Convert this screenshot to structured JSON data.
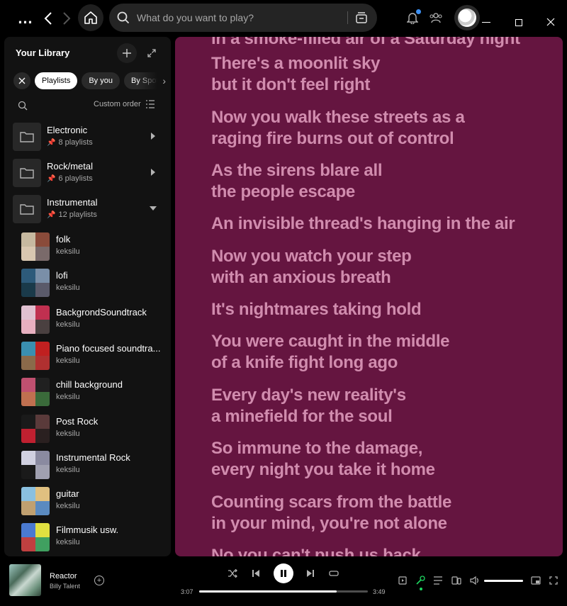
{
  "topbar": {
    "search_placeholder": "What do you want to play?",
    "icons": [
      "more-icon",
      "back-icon",
      "forward-icon",
      "home-icon",
      "search-icon",
      "browse-icon",
      "bell-icon",
      "friends-icon",
      "avatar",
      "minimize-icon",
      "maximize-icon",
      "close-icon"
    ]
  },
  "library": {
    "title": "Your Library",
    "filters": [
      "Playlists",
      "By you",
      "By Spoti"
    ],
    "active_filter": "Playlists",
    "sort_label": "Custom order",
    "folders": [
      {
        "name": "Electronic",
        "sub": "8 playlists",
        "expanded": false
      },
      {
        "name": "Rock/metal",
        "sub": "6 playlists",
        "expanded": false
      },
      {
        "name": "Instrumental",
        "sub": "12 playlists",
        "expanded": true
      }
    ],
    "playlists": [
      {
        "name": "folk",
        "owner": "keksilu",
        "colors": [
          "#c7b9a0",
          "#8a4b3a",
          "#d9c7b0",
          "#7a6a6a"
        ]
      },
      {
        "name": "lofi",
        "owner": "keksilu",
        "colors": [
          "#2d5a7a",
          "#7a8fa8",
          "#1a3a4a",
          "#5a5a6a"
        ]
      },
      {
        "name": "BackgrondSoundtrack",
        "owner": "keksilu",
        "colors": [
          "#e0c0d0",
          "#c03050",
          "#e8b0c0",
          "#4a4040"
        ]
      },
      {
        "name": "Piano focused soundtra...",
        "owner": "keksilu",
        "colors": [
          "#3a8fb0",
          "#c02020",
          "#8a6a4a",
          "#b03030"
        ]
      },
      {
        "name": "chill background",
        "owner": "keksilu",
        "colors": [
          "#c05070",
          "#202020",
          "#c07050",
          "#3a6a3a"
        ]
      },
      {
        "name": "Post Rock",
        "owner": "keksilu",
        "colors": [
          "#1a1a1a",
          "#5a3a3a",
          "#c02030",
          "#2a2020"
        ]
      },
      {
        "name": "Instrumental Rock",
        "owner": "keksilu",
        "colors": [
          "#d0d0e0",
          "#8a8aa0",
          "#1a1a1a",
          "#a0a0b0"
        ]
      },
      {
        "name": "guitar",
        "owner": "keksilu",
        "colors": [
          "#8ac0e0",
          "#e0c080",
          "#c0a070",
          "#5a8ac0"
        ]
      },
      {
        "name": "Filmmusik usw.",
        "owner": "keksilu",
        "colors": [
          "#4a7ad0",
          "#e0e040",
          "#c04040",
          "#40a060"
        ]
      }
    ]
  },
  "lyrics": {
    "lines": [
      {
        "text": "in a smoke-filled air of a Saturday night"
      },
      {
        "text": "There's a moonlit sky"
      },
      {
        "text": "but it don't feel right"
      },
      {
        "text": "Now you walk these streets as a"
      },
      {
        "text": "raging fire burns out of control"
      },
      {
        "text": "As the sirens blare all"
      },
      {
        "text": "the people escape"
      },
      {
        "text": "An invisible thread's hanging in the air"
      },
      {
        "text": "Now you watch your step"
      },
      {
        "text": "with an anxious breath"
      },
      {
        "text": "It's nightmares taking hold"
      },
      {
        "text": "You were caught in the middle"
      },
      {
        "text": "of a knife fight long ago"
      },
      {
        "text": "Every day's new reality's"
      },
      {
        "text": "a minefield for the soul"
      },
      {
        "text": "So immune to the damage,"
      },
      {
        "text": "every night you take it home"
      },
      {
        "text": "Counting scars from the battle"
      },
      {
        "text": "in your mind, you're not alone"
      },
      {
        "text": "No you can't push us back"
      }
    ],
    "background": "#651540",
    "text_color": "#d18cae"
  },
  "player": {
    "track_title": "Reactor",
    "artist": "Billy Talent",
    "elapsed": "3:07",
    "duration": "3:49",
    "progress_fraction": 0.816,
    "volume_fraction": 1.0,
    "accent": "#1ed760"
  }
}
